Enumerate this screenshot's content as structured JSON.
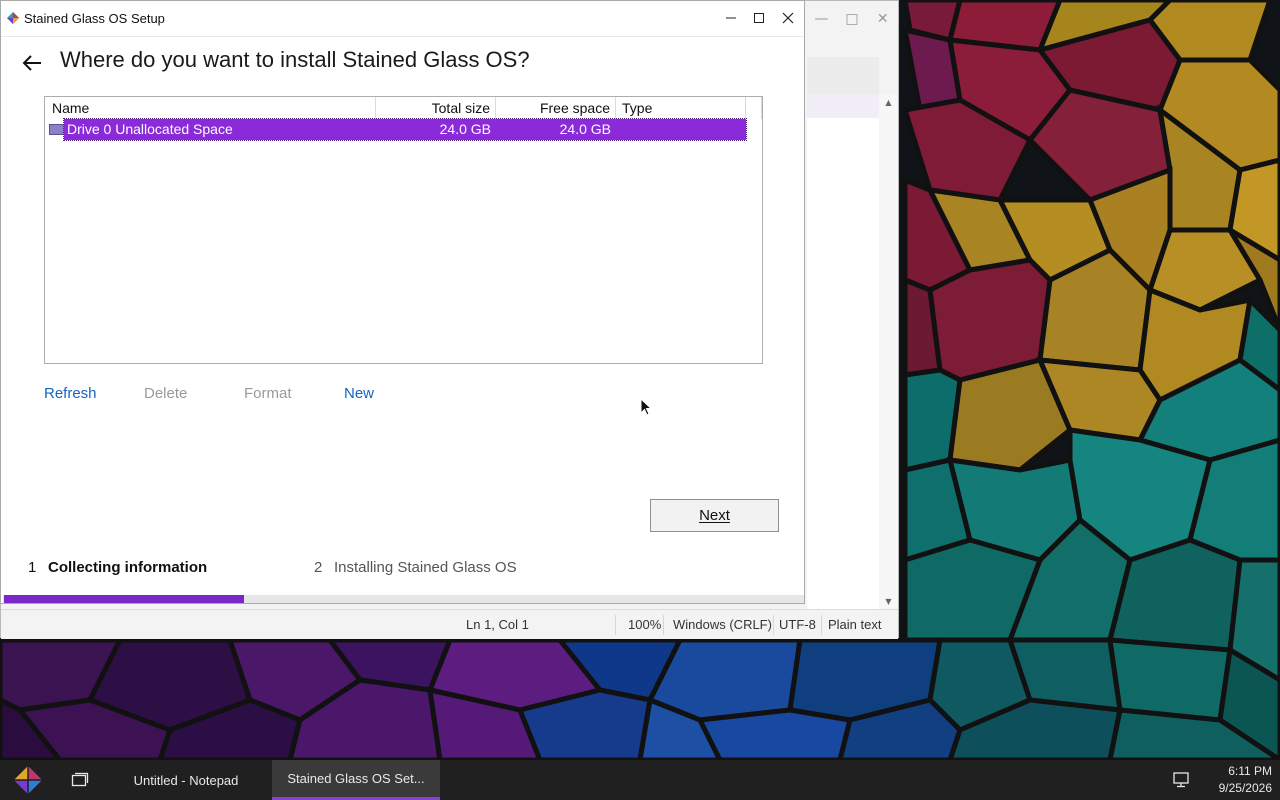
{
  "setup_window": {
    "title": "Stained Glass OS Setup",
    "heading": "Where do you want to install Stained Glass OS?",
    "columns": [
      "Name",
      "Total size",
      "Free space",
      "Type"
    ],
    "rows": [
      {
        "name": "Drive 0 Unallocated Space",
        "total_size": "24.0 GB",
        "free_space": "24.0 GB",
        "type": "",
        "selected": true
      }
    ],
    "actions": {
      "refresh": "Refresh",
      "delete": "Delete",
      "format": "Format",
      "new": "New"
    },
    "next_label": "Next",
    "steps": [
      {
        "number": "1",
        "label": "Collecting information",
        "active": true
      },
      {
        "number": "2",
        "label": "Installing Stained Glass OS",
        "active": false
      }
    ],
    "progress_fraction": 0.3,
    "accent_color": "#7828c8"
  },
  "notepad": {
    "status": {
      "position": "Ln 1, Col 1",
      "zoom": "100%",
      "line_ending": "Windows (CRLF)",
      "encoding": "UTF-8",
      "format": "Plain text"
    }
  },
  "taskbar": {
    "tasks": [
      {
        "label": "Untitled - Notepad",
        "active": false
      },
      {
        "label": "Stained Glass OS Set...",
        "active": true
      }
    ],
    "time": "6:11 PM",
    "date": "9/25/2026"
  }
}
